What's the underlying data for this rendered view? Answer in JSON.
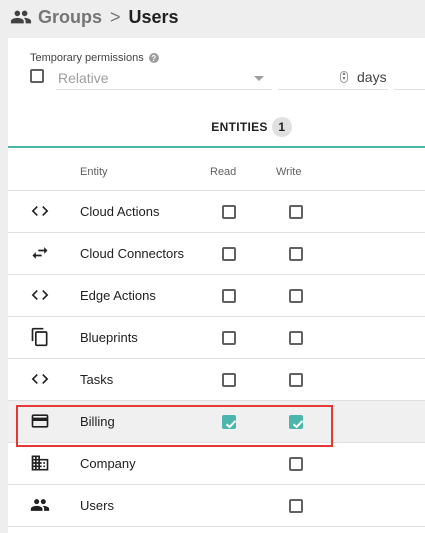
{
  "breadcrumb": {
    "parent": "Groups",
    "separator": ">",
    "current": "Users"
  },
  "temporary_permissions": {
    "label": "Temporary permissions",
    "help_icon": "help-icon",
    "checkbox_checked": false,
    "mode_value": "Relative",
    "duration_value": "",
    "unit": "days"
  },
  "tab": {
    "label": "ENTITIES",
    "count": "1"
  },
  "table": {
    "columns": [
      "Entity",
      "Read",
      "Write"
    ],
    "rows": [
      {
        "icon": "code-icon",
        "label": "Cloud Actions",
        "read": false,
        "write": false
      },
      {
        "icon": "swap-arrows-icon",
        "label": "Cloud Connectors",
        "read": false,
        "write": false
      },
      {
        "icon": "code-icon",
        "label": "Edge Actions",
        "read": false,
        "write": false
      },
      {
        "icon": "copy-icon",
        "label": "Blueprints",
        "read": false,
        "write": false
      },
      {
        "icon": "code-icon",
        "label": "Tasks",
        "read": false,
        "write": false
      },
      {
        "icon": "credit-card-icon",
        "label": "Billing",
        "read": true,
        "write": true
      },
      {
        "icon": "building-icon",
        "label": "Company",
        "read": null,
        "write": false
      },
      {
        "icon": "people-icon",
        "label": "Users",
        "read": null,
        "write": false
      }
    ]
  },
  "colors": {
    "accent": "#4db6ac",
    "highlight_border": "#e53935"
  }
}
